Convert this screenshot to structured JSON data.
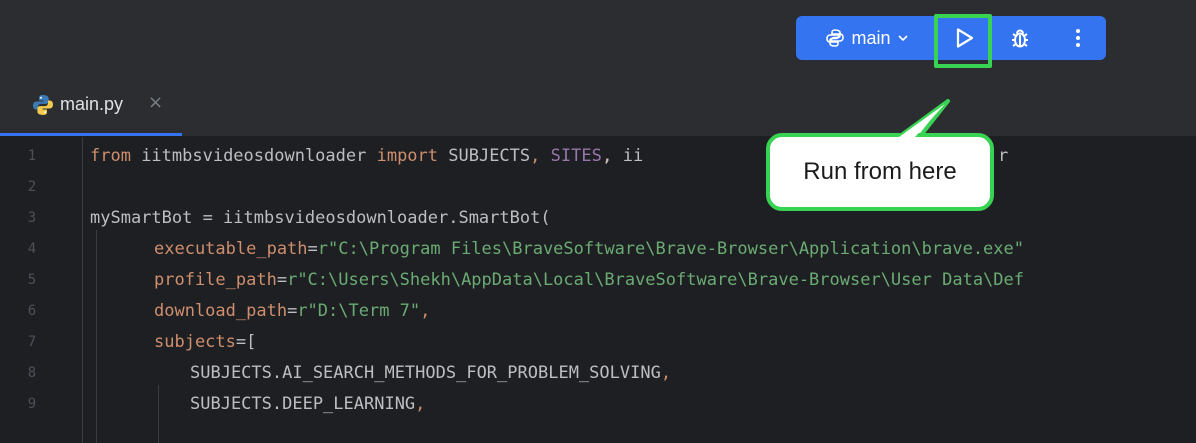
{
  "toolbar": {
    "run_config_label": "main",
    "accent_color": "#3574f0",
    "icons": [
      "python-icon",
      "chevron-down-icon",
      "run-icon",
      "debug-icon",
      "more-vertical-icon"
    ]
  },
  "highlight_color": "#39d353",
  "tab": {
    "label": "main.py",
    "close": "×"
  },
  "callout": {
    "text": "Run from here"
  },
  "editor": {
    "line_numbers": [
      "1",
      "2",
      "3",
      "4",
      "5",
      "6",
      "7",
      "8",
      "9"
    ],
    "lines": [
      {
        "a": "from",
        "b": " iitmbsvideosdownloader ",
        "c": "import",
        "d": " SUBJECTS",
        "e": ", ",
        "f": "SITES",
        "g": ", ii",
        "tail": "r"
      },
      {},
      {
        "full": "mySmartBot = iitmbsvideosdownloader.SmartBot("
      },
      {
        "p": "executable_path",
        "eq": "=",
        "s": "r\"C:\\Program Files\\BraveSoftware\\Brave-Browser\\Application\\brave.exe\""
      },
      {
        "p": "profile_path",
        "eq": "=",
        "s": "r\"C:\\Users\\Shekh\\AppData\\Local\\BraveSoftware\\Brave-Browser\\User Data\\Def"
      },
      {
        "p": "download_path",
        "eq": "=",
        "s": "r\"D:\\Term 7\"",
        "comma": ","
      },
      {
        "p": "subjects",
        "eq": "=["
      },
      {
        "full": "SUBJECTS.AI_SEARCH_METHODS_FOR_PROBLEM_SOLVING",
        "comma": ","
      },
      {
        "full": "SUBJECTS.DEEP_LEARNING",
        "comma": ","
      }
    ]
  }
}
